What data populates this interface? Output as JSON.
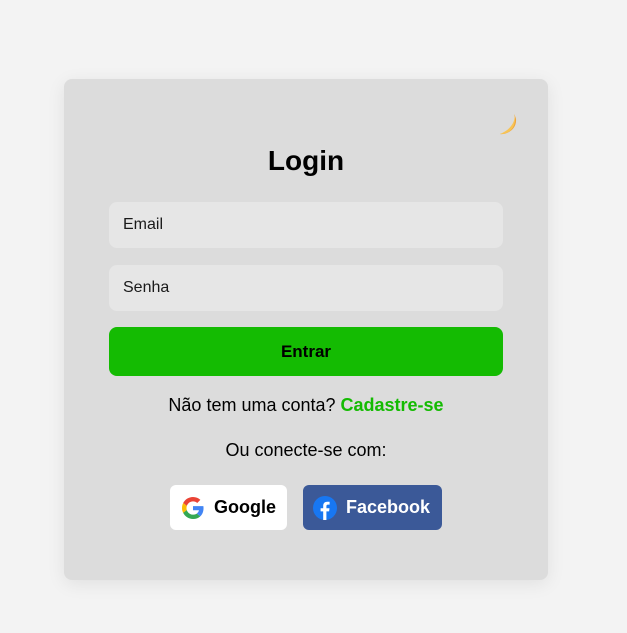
{
  "login": {
    "title": "Login",
    "email_placeholder": "Email",
    "password_placeholder": "Senha",
    "submit_label": "Entrar",
    "signup_prompt": "Não tem uma conta? ",
    "signup_link": "Cadastre-se",
    "connect_text": "Ou conecte-se com:",
    "google_label": "Google",
    "facebook_label": "Facebook"
  },
  "icons": {
    "theme_toggle": "moon-icon",
    "google": "google-icon",
    "facebook": "facebook-icon"
  },
  "colors": {
    "accent": "#14bb02",
    "facebook": "#3b5998",
    "card": "#dcdcdc",
    "field": "#e6e6e6"
  }
}
